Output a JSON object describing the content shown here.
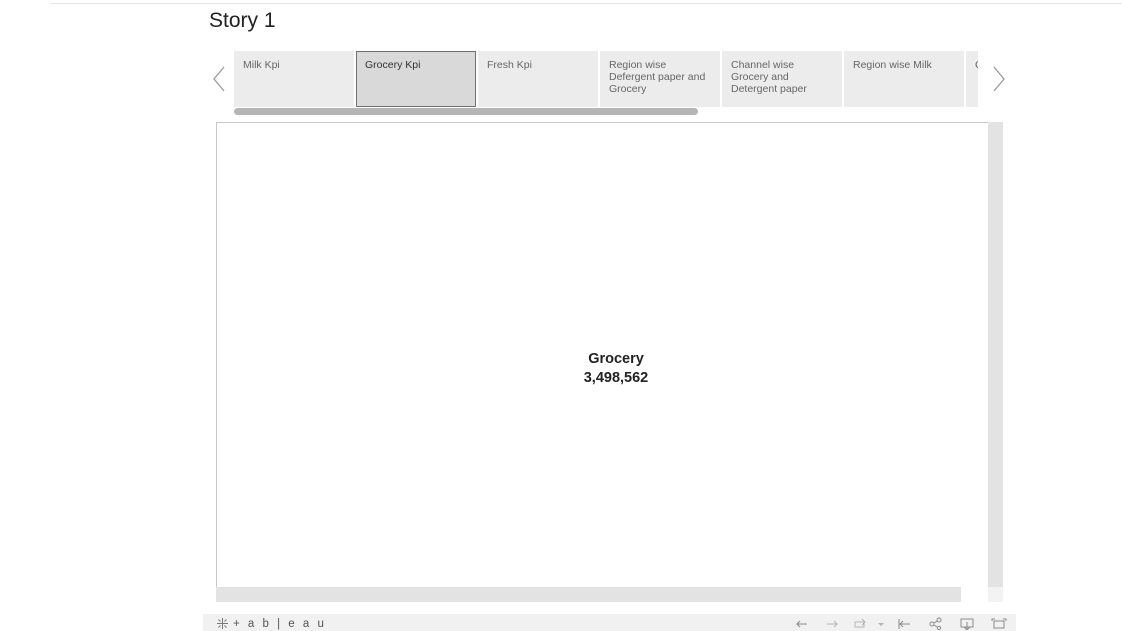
{
  "story": {
    "title": "Story 1"
  },
  "tabs": [
    {
      "label": "Milk Kpi",
      "active": false
    },
    {
      "label": "Grocery Kpi",
      "active": true
    },
    {
      "label": "Fresh Kpi",
      "active": false
    },
    {
      "label": "Region wise Defergent paper and Grocery",
      "active": false
    },
    {
      "label": "Channel wise Grocery and Detergent paper",
      "active": false
    },
    {
      "label": "Region wise Milk",
      "active": false
    },
    {
      "label": "Ch an",
      "active": false
    }
  ],
  "kpi": {
    "label": "Grocery",
    "value": "3,498,562"
  },
  "toolbar": {
    "logo_text": "+ a b | e a u",
    "buttons": [
      "undo-icon",
      "redo-icon",
      "revert-icon",
      "dropdown-caret-icon",
      "reset-to-start-icon",
      "share-icon",
      "download-icon",
      "fullscreen-icon"
    ]
  },
  "colors": {
    "tab_bg": "#ececec",
    "tab_active_bg": "#d9d9d9",
    "scrollbar": "#b5b5b5",
    "toolbar_bg": "#f1f1f1"
  }
}
